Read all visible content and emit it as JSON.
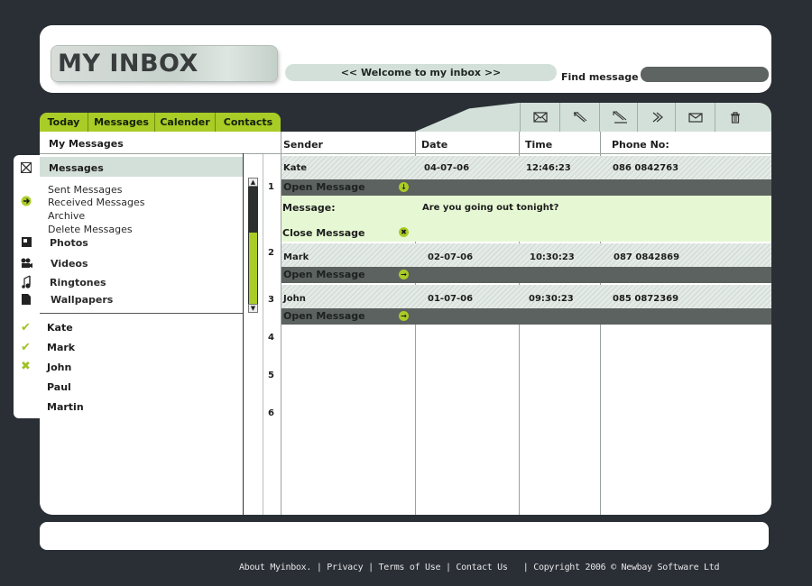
{
  "header": {
    "logo_text": "MY INBOX",
    "welcome": "<< Welcome to my inbox >>",
    "find_label": "Find message",
    "find_placeholder": ""
  },
  "tabs": [
    {
      "label": "Today"
    },
    {
      "label": "Messages"
    },
    {
      "label": "Calender"
    },
    {
      "label": "Contacts"
    }
  ],
  "toolbar": [
    {
      "icon": "envelope-icon"
    },
    {
      "icon": "reply-icon"
    },
    {
      "icon": "reply-all-icon"
    },
    {
      "icon": "forward-icon"
    },
    {
      "icon": "new-message-icon"
    },
    {
      "icon": "trash-icon"
    }
  ],
  "sidebar": {
    "section_title": "My Messages",
    "messages_header": "Messages",
    "folders": [
      "Sent Messages",
      "Received Messages",
      "Archive",
      "Delete Messages"
    ],
    "media": [
      "Photos",
      "Videos",
      "Ringtones",
      "Wallpapers"
    ],
    "contacts": [
      {
        "name": "Kate",
        "status": "check"
      },
      {
        "name": "Mark",
        "status": "check"
      },
      {
        "name": "John",
        "status": "cross"
      },
      {
        "name": "Paul",
        "status": "none"
      },
      {
        "name": "Martin",
        "status": "none"
      }
    ]
  },
  "table": {
    "columns": [
      "Sender",
      "Date",
      "Time",
      "Phone No:"
    ],
    "row_numbers": [
      "1",
      "2",
      "3",
      "4",
      "5",
      "6"
    ],
    "rows": [
      {
        "sender": "Kate",
        "date": "04-07-06",
        "time": "12:46:23",
        "phone": "086 0842763",
        "action": "Open Message"
      },
      {
        "sender": "Mark",
        "date": "02-07-06",
        "time": "10:30:23",
        "phone": "087 0842869",
        "action": "Open Message"
      },
      {
        "sender": "John",
        "date": "01-07-06",
        "time": "09:30:23",
        "phone": "085 0872369",
        "action": "Open Message"
      }
    ],
    "open_message": {
      "message_label": "Message:",
      "message_text": "Are you going out tonight?",
      "close_label": "Close Message"
    }
  },
  "footer": {
    "about": "About Myinbox.",
    "privacy": "Privacy",
    "terms": "Terms of Use",
    "contact": "Contact Us",
    "copyright": "Copyright 2006 © Newbay Software Ltd"
  },
  "colors": {
    "accent_green": "#a9cc26",
    "pale_green": "#d3e0d9",
    "message_bg": "#e6f8d3",
    "dark_bar": "#5b625f",
    "page_bg": "#2a2f36"
  }
}
